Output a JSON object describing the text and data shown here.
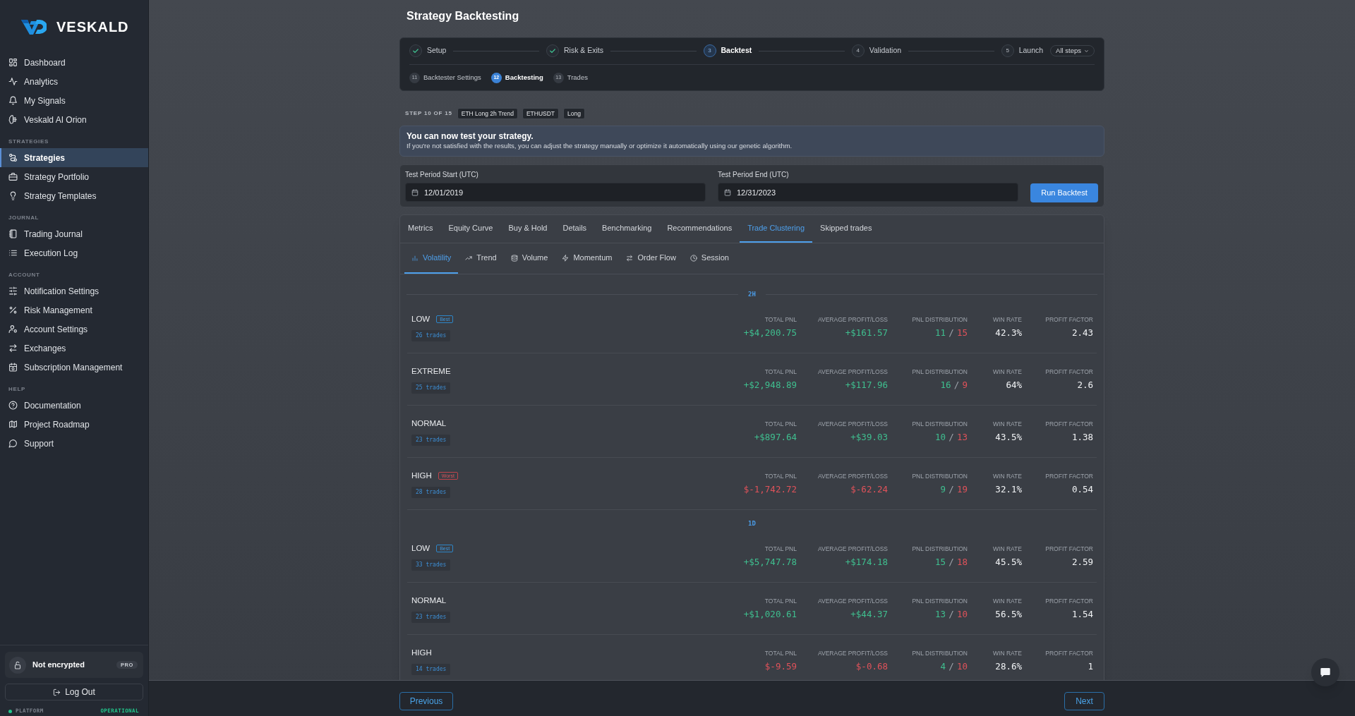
{
  "sidebar": {
    "brand": "VESKALD",
    "sections": [
      {
        "items": [
          {
            "label": "Dashboard",
            "selected": false
          },
          {
            "label": "Analytics",
            "selected": false
          },
          {
            "label": "My Signals",
            "selected": false
          },
          {
            "label": "Veskald AI Orion",
            "selected": false
          }
        ]
      },
      {
        "title": "STRATEGIES",
        "items": [
          {
            "label": "Strategies",
            "selected": true
          },
          {
            "label": "Strategy Portfolio",
            "selected": false
          },
          {
            "label": "Strategy Templates",
            "selected": false
          }
        ]
      },
      {
        "title": "JOURNAL",
        "items": [
          {
            "label": "Trading Journal",
            "selected": false
          },
          {
            "label": "Execution Log",
            "selected": false
          }
        ]
      },
      {
        "title": "ACCOUNT",
        "items": [
          {
            "label": "Notification Settings",
            "selected": false
          },
          {
            "label": "Risk Management",
            "selected": false
          },
          {
            "label": "Account Settings",
            "selected": false
          },
          {
            "label": "Exchanges",
            "selected": false
          },
          {
            "label": "Subscription Management",
            "selected": false
          }
        ]
      },
      {
        "title": "HELP",
        "items": [
          {
            "label": "Documentation",
            "selected": false
          },
          {
            "label": "Project Roadmap",
            "selected": false
          },
          {
            "label": "Support",
            "selected": false
          }
        ]
      }
    ],
    "security": {
      "label": "Not encrypted",
      "plan": "PRO"
    },
    "logout": "Log Out",
    "status": {
      "label": "PLATFORM",
      "value": "OPERATIONAL",
      "healthy": true
    }
  },
  "page_title": "Strategy Backtesting",
  "stepper": {
    "steps": [
      {
        "label": "Setup",
        "completed": true,
        "selected": false
      },
      {
        "label": "Risk & Exits",
        "completed": true,
        "selected": false
      },
      {
        "number": "3",
        "label": "Backtest",
        "completed": false,
        "selected": true
      },
      {
        "number": "4",
        "label": "Validation",
        "completed": false,
        "selected": false
      },
      {
        "number": "5",
        "label": "Launch",
        "completed": false,
        "selected": false
      }
    ],
    "all_steps": "All steps",
    "substeps": [
      {
        "number": "11",
        "label": "Backtester Settings",
        "selected": false
      },
      {
        "number": "12",
        "label": "Backtesting",
        "selected": true
      },
      {
        "number": "13",
        "label": "Trades",
        "selected": false
      }
    ]
  },
  "step_info": {
    "label": "STEP 10 OF 15",
    "tags": [
      "ETH Long 2h Trend",
      "ETHUSDT",
      "Long"
    ]
  },
  "notice": {
    "title": "You can now test your strategy.",
    "text": "If you're not satisfied with the results, you can adjust the strategy manually or optimize it automatically using our genetic algorithm."
  },
  "period": {
    "fields": [
      {
        "label": "Test Period Start (UTC)",
        "value": "12/01/2019"
      },
      {
        "label": "Test Period End (UTC)",
        "value": "12/31/2023"
      }
    ],
    "button": "Run Backtest"
  },
  "tabs": [
    {
      "label": "Metrics",
      "selected": false
    },
    {
      "label": "Equity Curve",
      "selected": false
    },
    {
      "label": "Buy & Hold",
      "selected": false
    },
    {
      "label": "Details",
      "selected": false
    },
    {
      "label": "Benchmarking",
      "selected": false
    },
    {
      "label": "Recommendations",
      "selected": false
    },
    {
      "label": "Trade Clustering",
      "selected": true
    },
    {
      "label": "Skipped trades",
      "selected": false
    }
  ],
  "subtabs": [
    {
      "label": "Volatility",
      "selected": true
    },
    {
      "label": "Trend",
      "selected": false
    },
    {
      "label": "Volume",
      "selected": false
    },
    {
      "label": "Momentum",
      "selected": false
    },
    {
      "label": "Order Flow",
      "selected": false
    },
    {
      "label": "Session",
      "selected": false
    }
  ],
  "groups": [
    {
      "label": "2H",
      "rows": [
        {
          "name": "LOW",
          "badge": {
            "kind": "best",
            "text": "Best"
          },
          "trades": "26 trades",
          "metrics": [
            {
              "kind": "gain",
              "label": "TOTAL PNL",
              "value": "+$4,200.75"
            },
            {
              "kind": "gain",
              "label": "AVERAGE PROFIT/LOSS",
              "value": "+$161.57"
            },
            {
              "kind": "split",
              "label": "PNL DISTRIBUTION",
              "wins": "11",
              "separator": "/",
              "losses": "15"
            },
            {
              "kind": "plain",
              "label": "WIN RATE",
              "value": "42.3%"
            },
            {
              "kind": "plain",
              "label": "PROFIT FACTOR",
              "value": "2.43"
            }
          ]
        },
        {
          "name": "EXTREME",
          "trades": "25 trades",
          "metrics": [
            {
              "kind": "gain",
              "label": "TOTAL PNL",
              "value": "+$2,948.89"
            },
            {
              "kind": "gain",
              "label": "AVERAGE PROFIT/LOSS",
              "value": "+$117.96"
            },
            {
              "kind": "split",
              "label": "PNL DISTRIBUTION",
              "wins": "16",
              "separator": "/",
              "losses": "9"
            },
            {
              "kind": "plain",
              "label": "WIN RATE",
              "value": "64%"
            },
            {
              "kind": "plain",
              "label": "PROFIT FACTOR",
              "value": "2.6"
            }
          ]
        },
        {
          "name": "NORMAL",
          "trades": "23 trades",
          "metrics": [
            {
              "kind": "gain",
              "label": "TOTAL PNL",
              "value": "+$897.64"
            },
            {
              "kind": "gain",
              "label": "AVERAGE PROFIT/LOSS",
              "value": "+$39.03"
            },
            {
              "kind": "split",
              "label": "PNL DISTRIBUTION",
              "wins": "10",
              "separator": "/",
              "losses": "13"
            },
            {
              "kind": "plain",
              "label": "WIN RATE",
              "value": "43.5%"
            },
            {
              "kind": "plain",
              "label": "PROFIT FACTOR",
              "value": "1.38"
            }
          ]
        },
        {
          "name": "HIGH",
          "badge": {
            "kind": "worst",
            "text": "Worst"
          },
          "trades": "28 trades",
          "metrics": [
            {
              "kind": "loss",
              "label": "TOTAL PNL",
              "value": "$-1,742.72"
            },
            {
              "kind": "loss",
              "label": "AVERAGE PROFIT/LOSS",
              "value": "$-62.24"
            },
            {
              "kind": "split",
              "label": "PNL DISTRIBUTION",
              "wins": "9",
              "separator": "/",
              "losses": "19"
            },
            {
              "kind": "plain",
              "label": "WIN RATE",
              "value": "32.1%"
            },
            {
              "kind": "plain",
              "label": "PROFIT FACTOR",
              "value": "0.54"
            }
          ]
        }
      ]
    },
    {
      "label": "1D",
      "rows": [
        {
          "name": "LOW",
          "badge": {
            "kind": "best",
            "text": "Best"
          },
          "trades": "33 trades",
          "metrics": [
            {
              "kind": "gain",
              "label": "TOTAL PNL",
              "value": "+$5,747.78"
            },
            {
              "kind": "gain",
              "label": "AVERAGE PROFIT/LOSS",
              "value": "+$174.18"
            },
            {
              "kind": "split",
              "label": "PNL DISTRIBUTION",
              "wins": "15",
              "separator": "/",
              "losses": "18"
            },
            {
              "kind": "plain",
              "label": "WIN RATE",
              "value": "45.5%"
            },
            {
              "kind": "plain",
              "label": "PROFIT FACTOR",
              "value": "2.59"
            }
          ]
        },
        {
          "name": "NORMAL",
          "trades": "23 trades",
          "metrics": [
            {
              "kind": "gain",
              "label": "TOTAL PNL",
              "value": "+$1,020.61"
            },
            {
              "kind": "gain",
              "label": "AVERAGE PROFIT/LOSS",
              "value": "+$44.37"
            },
            {
              "kind": "split",
              "label": "PNL DISTRIBUTION",
              "wins": "13",
              "separator": "/",
              "losses": "10"
            },
            {
              "kind": "plain",
              "label": "WIN RATE",
              "value": "56.5%"
            },
            {
              "kind": "plain",
              "label": "PROFIT FACTOR",
              "value": "1.54"
            }
          ]
        },
        {
          "name": "HIGH",
          "trades": "14 trades",
          "metrics": [
            {
              "kind": "loss",
              "label": "TOTAL PNL",
              "value": "$-9.59"
            },
            {
              "kind": "loss",
              "label": "AVERAGE PROFIT/LOSS",
              "value": "$-0.68"
            },
            {
              "kind": "split",
              "label": "PNL DISTRIBUTION",
              "wins": "4",
              "separator": "/",
              "losses": "10"
            },
            {
              "kind": "plain",
              "label": "WIN RATE",
              "value": "28.6%"
            },
            {
              "kind": "plain",
              "label": "PROFIT FACTOR",
              "value": "1"
            }
          ]
        }
      ]
    }
  ],
  "footer": {
    "previous": "Previous",
    "next": "Next"
  }
}
